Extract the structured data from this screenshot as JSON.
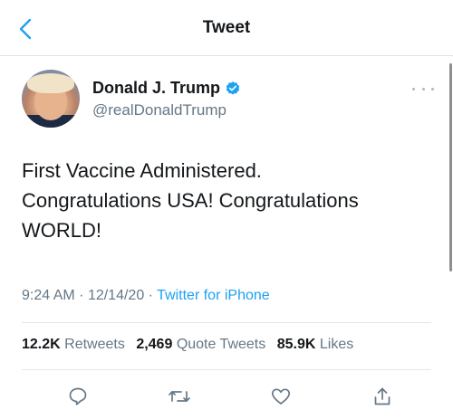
{
  "header": {
    "title": "Tweet"
  },
  "author": {
    "name": "Donald J. Trump",
    "handle": "@realDonaldTrump",
    "verified": true
  },
  "tweet": {
    "lines": [
      "First Vaccine Administered.",
      "Congratulations USA! Congratulations",
      "WORLD!"
    ]
  },
  "meta": {
    "time": "9:24 AM",
    "separator": "·",
    "date": "12/14/20",
    "source": "Twitter for iPhone"
  },
  "stats": {
    "retweets_count": "12.2K",
    "retweets_label": "Retweets",
    "quote_count": "2,469",
    "quote_label": "Quote Tweets",
    "likes_count": "85.9K",
    "likes_label": "Likes"
  },
  "colors": {
    "accent": "#1da1f2",
    "secondary_text": "#657786",
    "primary_text": "#14171a"
  },
  "icons": [
    "back-icon",
    "verified-icon",
    "more-icon",
    "reply-icon",
    "retweet-icon",
    "like-icon",
    "share-icon"
  ]
}
